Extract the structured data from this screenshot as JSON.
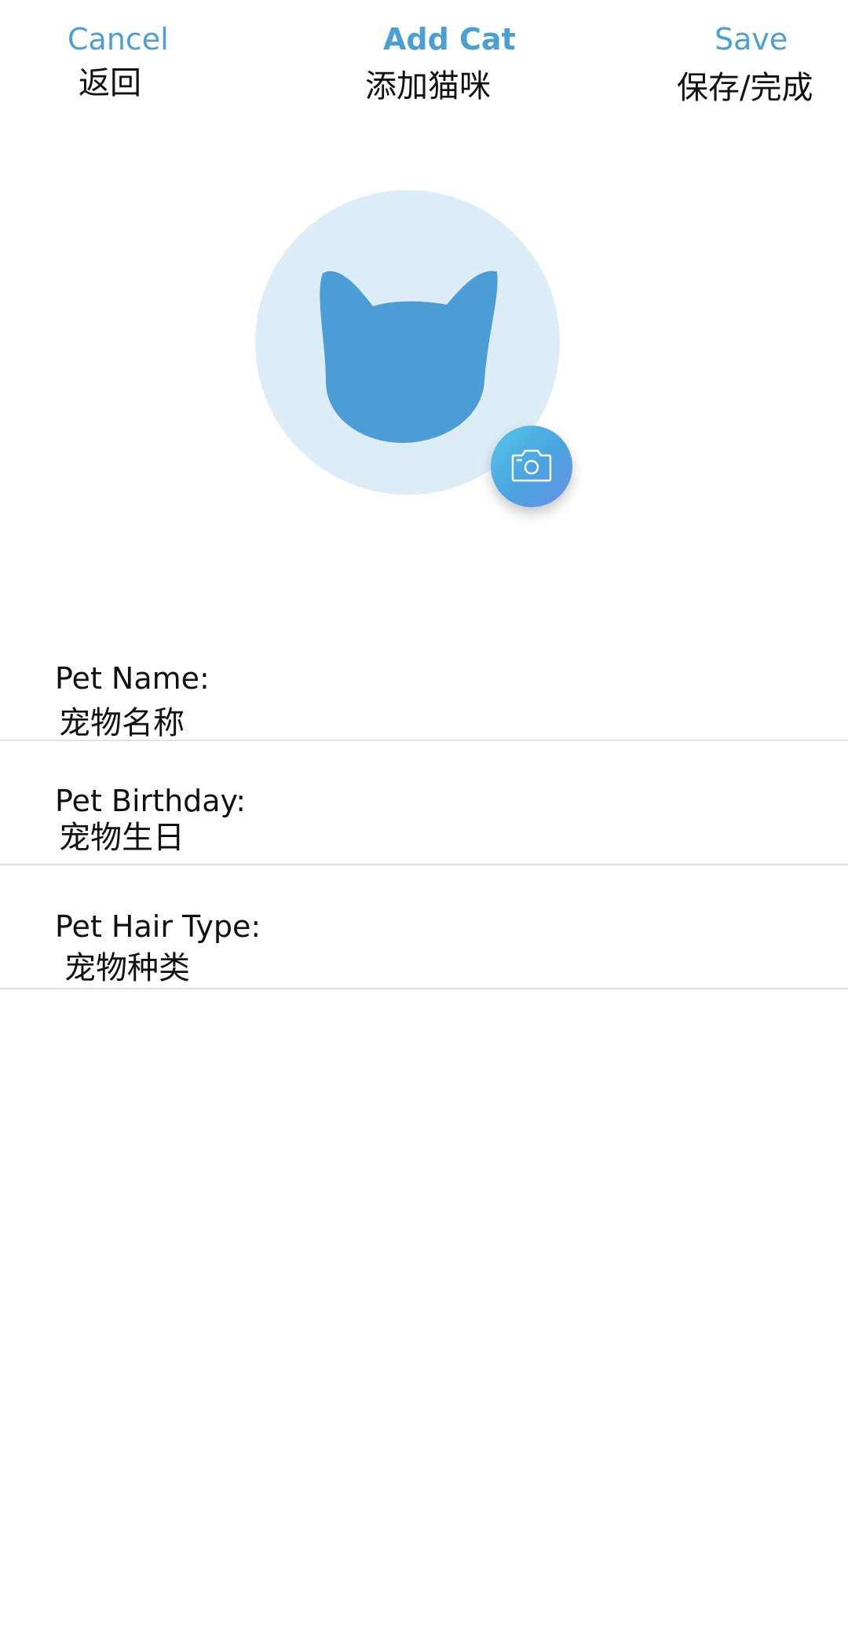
{
  "header": {
    "cancel_label": "Cancel",
    "cancel_sub": "返回",
    "title": "Add Cat",
    "title_sub": "添加猫咪",
    "save_label": "Save",
    "save_sub": "保存/完成"
  },
  "avatar": {
    "icon": "cat-head-icon",
    "camera_icon": "camera-icon"
  },
  "form": {
    "fields": [
      {
        "label": "Pet Name:",
        "value": "宠物名称"
      },
      {
        "label": "Pet Birthday:",
        "value": "宠物生日"
      },
      {
        "label": "Pet Hair Type:",
        "value": "宠物种类"
      }
    ]
  },
  "colors": {
    "accent": "#4a9fd4",
    "avatar_bg": "#ddedf8",
    "cat_fill": "#4c9cd6",
    "divider": "#e2e2e2"
  }
}
